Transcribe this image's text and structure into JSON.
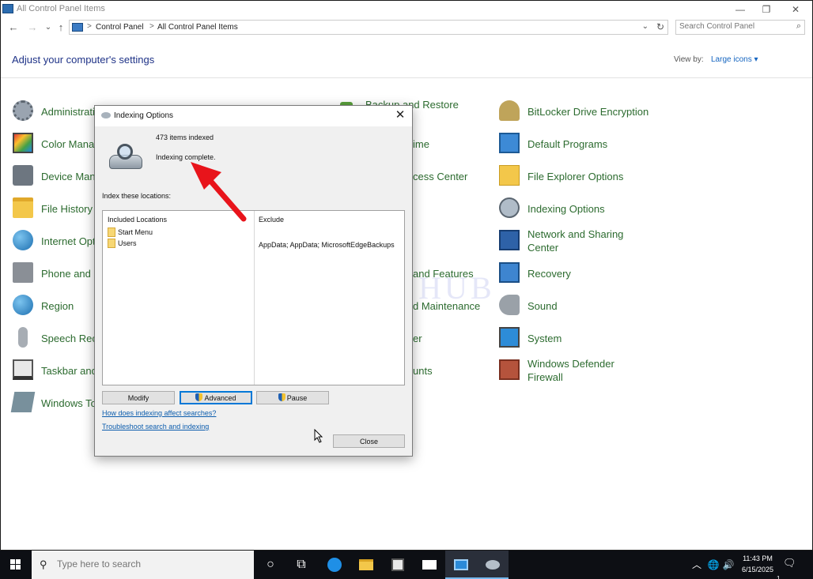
{
  "window": {
    "title": "All Control Panel Items",
    "minimize": "—",
    "restore": "❐",
    "close": "✕"
  },
  "nav": {
    "back": "←",
    "forward": "→",
    "recent": "⌄",
    "up": "↑",
    "breadcrumb": [
      "Control Panel",
      "All Control Panel Items"
    ],
    "breadcrumb_sep": ">",
    "dropdown": "⌄",
    "refresh": "↻",
    "search_placeholder": "Search Control Panel"
  },
  "header": {
    "title": "Adjust your computer's settings",
    "view_by_label": "View by:",
    "view_by_value": "Large icons ▾"
  },
  "items": {
    "administrative": "Administrati",
    "color": "Color Manag",
    "device": "Device Mana",
    "file_history": "File History",
    "internet": "Internet Opt",
    "phone": "Phone and M",
    "region": "Region",
    "speech": "Speech Reco",
    "taskbar": "Taskbar and",
    "windows_tools": "Windows To",
    "backup_line1": "Backup and Restore",
    "backup_line2": "7)",
    "datetime": "ime",
    "ease": "cess Center",
    "programs": "and Features",
    "security": "d Maintenance",
    "troubleshoot": "er",
    "user_accounts": "unts",
    "bitlocker": "BitLocker Drive Encryption",
    "default_programs": "Default Programs",
    "file_explorer": "File Explorer Options",
    "indexing": "Indexing Options",
    "network_line1": "Network and Sharing",
    "network_line2": "Center",
    "recovery": "Recovery",
    "sound": "Sound",
    "system": "System",
    "defender_line1": "Windows Defender",
    "defender_line2": "Firewall"
  },
  "watermark": "IT Pros HUB",
  "dialog": {
    "title": "Indexing Options",
    "close": "✕",
    "items_indexed": "473 items indexed",
    "status": "Indexing complete.",
    "locations_label": "Index these locations:",
    "col_included": "Included Locations",
    "col_exclude": "Exclude",
    "locations": [
      "Start Menu",
      "Users"
    ],
    "exclude_text": "AppData; AppData; MicrosoftEdgeBackups",
    "buttons": {
      "modify": "Modify",
      "advanced": "Advanced",
      "pause": "Pause",
      "close": "Close"
    },
    "links": {
      "how": "How does indexing affect searches?",
      "troubleshoot": "Troubleshoot search and indexing"
    }
  },
  "taskbar": {
    "search_placeholder": "Type here to search",
    "search_icon": "⚲",
    "cortana": "○",
    "task_view": "⧉",
    "tray_chevron": "︿",
    "network_icon": "🌐",
    "volume_icon": "🔊",
    "time": "11:43 PM",
    "date": "6/15/2025",
    "notifications": "1",
    "notification_icon": "🗨"
  },
  "colors": {
    "accent": "#0078d7",
    "link": "#0b5cad",
    "item_text": "#2c6b2f",
    "annotation_arrow": "#e8141b"
  }
}
